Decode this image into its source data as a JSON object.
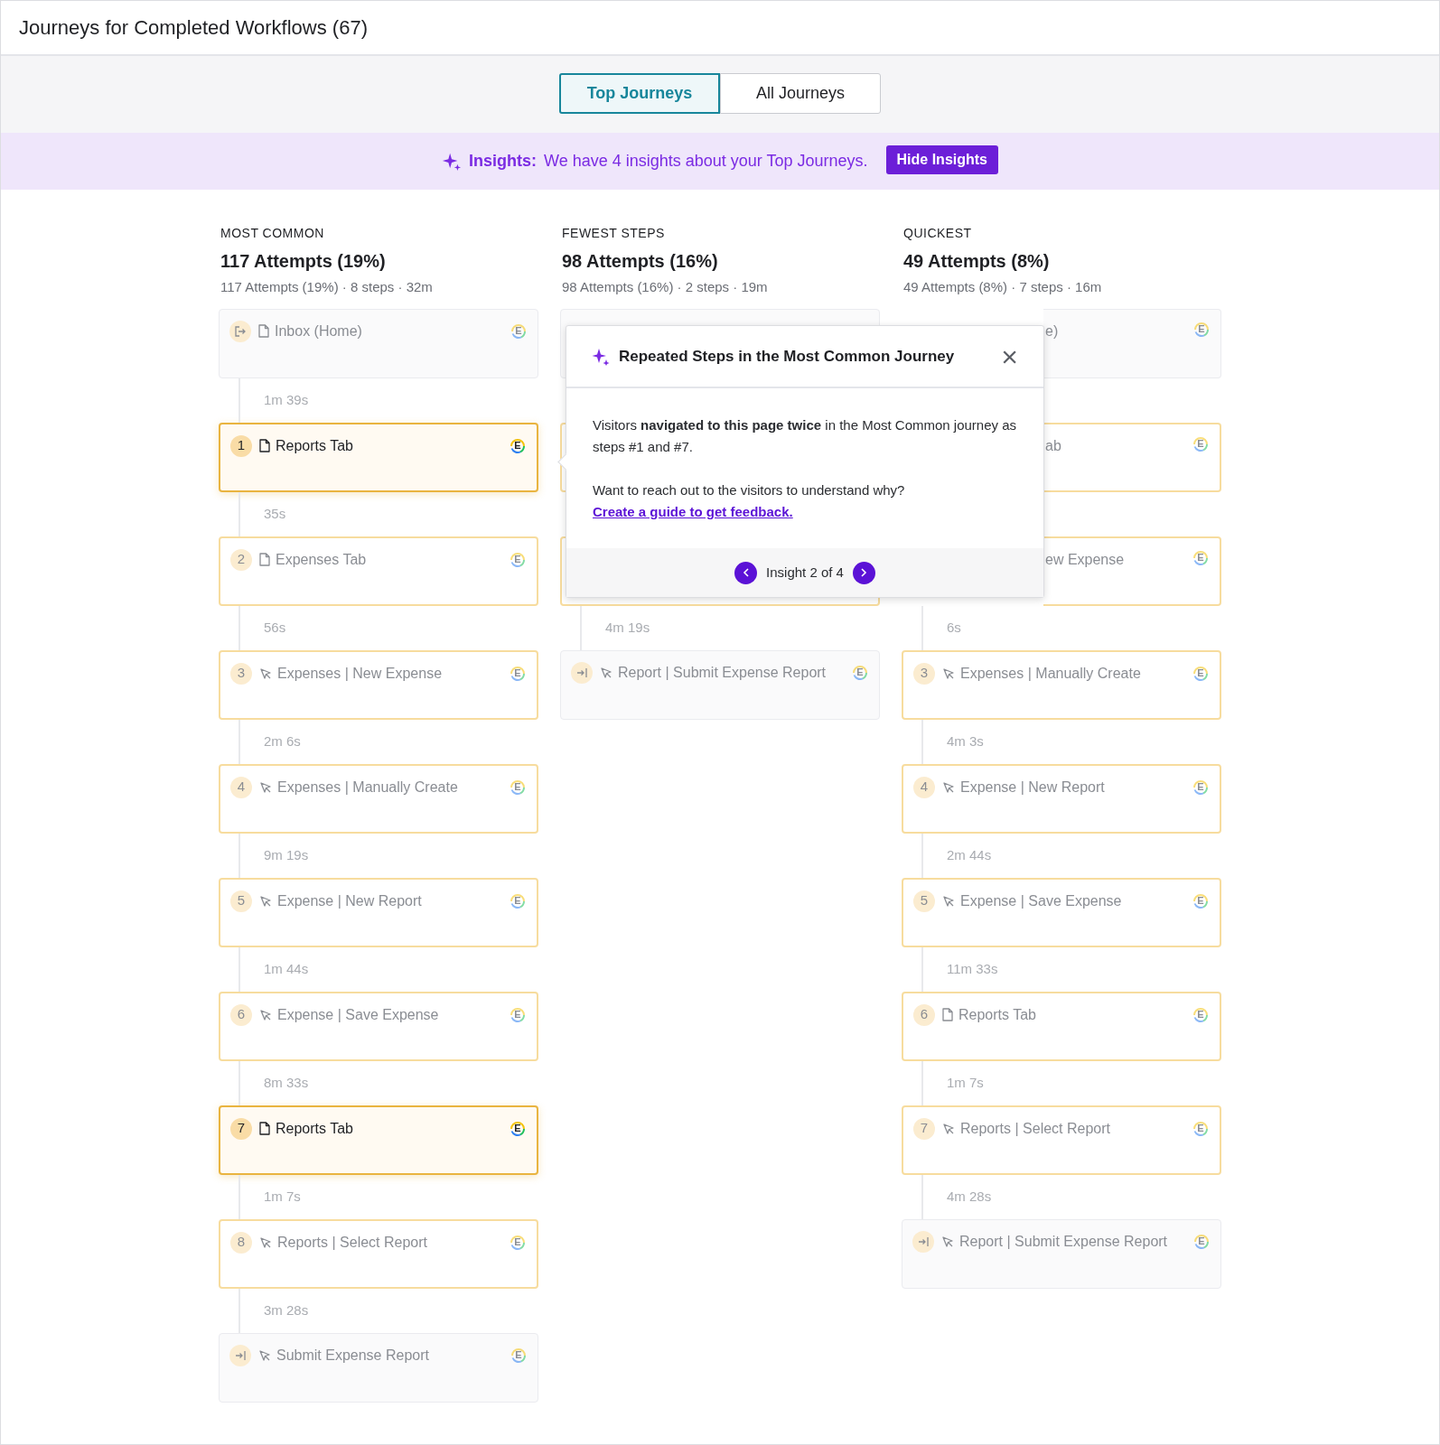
{
  "header": {
    "title": "Journeys for Completed Workflows (67)"
  },
  "tabs": [
    {
      "label": "Top Journeys",
      "selected": true
    },
    {
      "label": "All Journeys",
      "selected": false
    }
  ],
  "insights_bar": {
    "label": "Insights:",
    "message": "We have 4 insights about your Top Journeys.",
    "button": "Hide Insights"
  },
  "journeys": [
    {
      "category": "MOST COMMON",
      "title": "117 Attempts (19%)",
      "summary": "117 Attempts (19%) · 8 steps · 32m",
      "steps": [
        {
          "kind": "entry",
          "label": "Inbox (Home)",
          "badge": "E"
        },
        {
          "kind": "page",
          "number": "1",
          "label": "Reports Tab",
          "badge": "E",
          "highlighted": true,
          "duration": "1m 39s"
        },
        {
          "kind": "page",
          "number": "2",
          "label": "Expenses Tab",
          "badge": "E",
          "highlighted": false,
          "duration": "35s"
        },
        {
          "kind": "click",
          "number": "3",
          "label": "Expenses | New Expense",
          "badge": "E",
          "highlighted": false,
          "duration": "56s"
        },
        {
          "kind": "click",
          "number": "4",
          "label": "Expenses | Manually Create",
          "badge": "E",
          "highlighted": false,
          "duration": "2m 6s"
        },
        {
          "kind": "click",
          "number": "5",
          "label": "Expense | New Report",
          "badge": "E",
          "highlighted": false,
          "duration": "9m 19s"
        },
        {
          "kind": "click",
          "number": "6",
          "label": "Expense | Save Expense",
          "badge": "E",
          "highlighted": false,
          "duration": "1m 44s"
        },
        {
          "kind": "page",
          "number": "7",
          "label": "Reports Tab",
          "badge": "E",
          "highlighted": true,
          "duration": "8m 33s"
        },
        {
          "kind": "click",
          "number": "8",
          "label": "Reports | Select Report",
          "badge": "E",
          "highlighted": false,
          "duration": "1m 7s"
        },
        {
          "kind": "exit",
          "label": "Submit Expense Report",
          "badge": "E",
          "duration": "3m 28s"
        }
      ]
    },
    {
      "category": "FEWEST STEPS",
      "title": "98 Attempts (16%)",
      "summary": "98 Attempts (16%) · 2 steps · 19m",
      "steps": [
        {
          "kind": "covered_entry"
        },
        {
          "kind": "covered_step"
        },
        {
          "kind": "covered_step"
        },
        {
          "kind": "exit",
          "label": "Report | Submit Expense Report",
          "badge": "E",
          "duration": "4m 19s"
        }
      ]
    },
    {
      "category": "QUICKEST",
      "title": "49 Attempts (8%)",
      "summary": "49 Attempts (8%) · 7 steps · 16m",
      "steps": [
        {
          "kind": "covered_entry",
          "label": "e)",
          "badge": "E"
        },
        {
          "kind": "covered_step",
          "label": "ab",
          "badge": "E"
        },
        {
          "kind": "covered_step",
          "label": "ew Expense",
          "badge": "E"
        },
        {
          "kind": "click",
          "number": "3",
          "label": "Expenses | Manually Create",
          "badge": "E",
          "highlighted": false,
          "duration": "6s"
        },
        {
          "kind": "click",
          "number": "4",
          "label": "Expense | New Report",
          "badge": "E",
          "highlighted": false,
          "duration": "4m 3s"
        },
        {
          "kind": "click",
          "number": "5",
          "label": "Expense | Save Expense",
          "badge": "E",
          "highlighted": false,
          "duration": "2m 44s"
        },
        {
          "kind": "page",
          "number": "6",
          "label": "Reports Tab",
          "badge": "E",
          "highlighted": false,
          "duration": "11m 33s"
        },
        {
          "kind": "click",
          "number": "7",
          "label": "Reports | Select Report",
          "badge": "E",
          "highlighted": false,
          "duration": "1m 7s"
        },
        {
          "kind": "exit",
          "label": "Report | Submit Expense Report",
          "badge": "E",
          "duration": "4m 28s"
        }
      ]
    }
  ],
  "popover": {
    "title": "Repeated Steps in the Most Common Journey",
    "close": "×",
    "body": "Visitors **navigated to this page twice** in the Most Common journey as steps #1 and #7.",
    "question": "Want to reach out to the visitors to understand why?",
    "link": "Create a guide to get feedback.",
    "pager": "Insight 2 of 4"
  }
}
